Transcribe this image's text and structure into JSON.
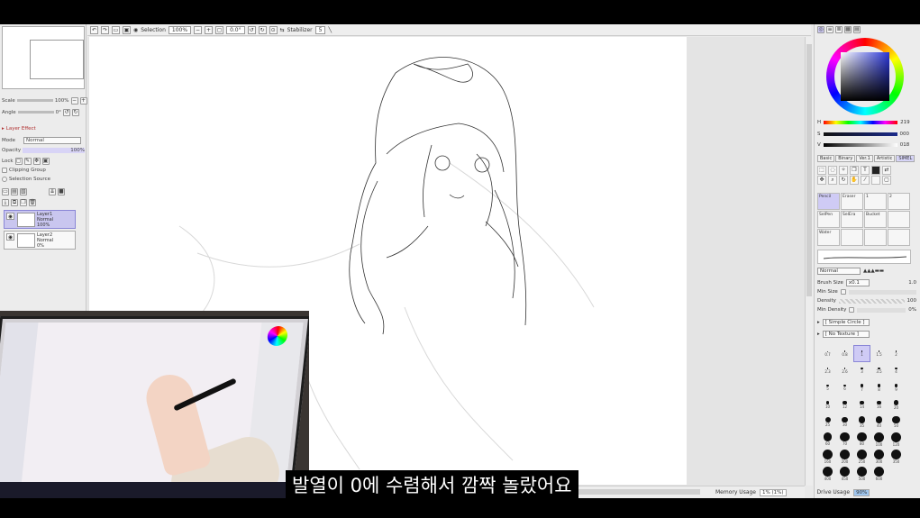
{
  "toolbar": {
    "selection_label": "Selection",
    "zoom": "100%",
    "angle": "0.0°",
    "stabilizer_label": "Stabilizer",
    "stabilizer_value": "5"
  },
  "navigator": {
    "scale_label": "Scale",
    "scale_value": "100%",
    "angle_label": "Angle",
    "angle_value": "0°"
  },
  "layer_panel": {
    "effect_label": "Layer Effect",
    "mode_label": "Mode",
    "mode_value": "Normal",
    "opacity_label": "Opacity",
    "opacity_value": "100%",
    "lock_label": "Lock",
    "clipping_label": "Clipping Group",
    "selection_source_label": "Selection Source",
    "layers": [
      {
        "name": "Layer1",
        "mode": "Normal",
        "opacity": "100%"
      },
      {
        "name": "Layer2",
        "mode": "Normal",
        "opacity": "0%"
      }
    ]
  },
  "color": {
    "h_label": "H",
    "h_value": "219",
    "s_label": "S",
    "s_value": "000",
    "v_label": "V",
    "v_value": "018"
  },
  "brush_tabs": [
    "Basic",
    "Binary",
    "Ver.1",
    "Artistic",
    "SIMEL"
  ],
  "brush_tools": [
    "Pencil",
    "Eraser",
    "1",
    "2",
    "SelPen",
    "SelEra",
    "Bucket",
    "",
    "Water",
    "",
    "",
    ""
  ],
  "brush_props": {
    "blend_value": "Normal",
    "size_label": "Brush Size",
    "size_mult": "x0.1",
    "size_value": "1.0",
    "min_size_label": "Min Size",
    "density_label": "Density",
    "density_value": "100",
    "min_density_label": "Min Density",
    "min_density_value": "0%",
    "shape_value": "[ Simple Circle ]",
    "texture_value": "[ No Texture ]"
  },
  "brush_sizes": [
    "0.7",
    "0.8",
    "1",
    "1.5",
    "2",
    "2.3",
    "2.6",
    "3",
    "3.5",
    "4",
    "5",
    "6",
    "7",
    "8",
    "9",
    "10",
    "12",
    "14",
    "16",
    "20",
    "25",
    "30",
    "35",
    "40",
    "50",
    "60",
    "70",
    "80",
    "100",
    "120",
    "160",
    "200",
    "250",
    "300",
    "350",
    "400",
    "450",
    "500",
    "600"
  ],
  "status": {
    "memory_label": "Memory Usage",
    "memory_value": "1% (1%)",
    "drive_label": "Drive Usage",
    "drive_value": "90%"
  },
  "subtitle": "발열이 0에 수렴해서 깜짝 놀랐어요"
}
